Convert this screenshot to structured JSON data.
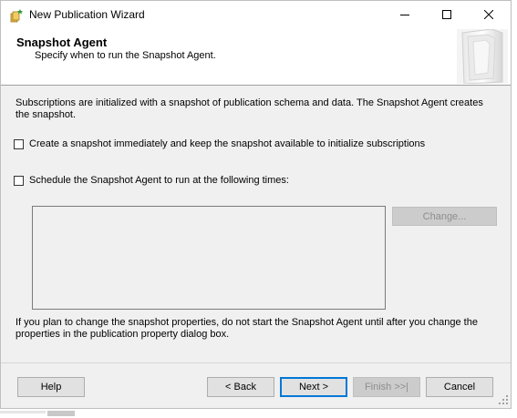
{
  "window": {
    "title": "New Publication Wizard",
    "controls": {
      "minimize": "minimize-icon",
      "maximize": "maximize-icon",
      "close": "close-icon"
    }
  },
  "header": {
    "title": "Snapshot Agent",
    "subtitle": "Specify when to run the Snapshot Agent."
  },
  "content": {
    "description": "Subscriptions are initialized with a snapshot of publication schema and data. The Snapshot Agent creates the snapshot.",
    "option_immediate": {
      "label": "Create a snapshot immediately and keep the snapshot available to initialize subscriptions",
      "checked": false
    },
    "option_schedule": {
      "label": "Schedule the Snapshot Agent to run at the following times:",
      "checked": false
    },
    "schedule_text": "",
    "change_button": "Change...",
    "note": "If you plan to change the snapshot properties, do not start the Snapshot Agent until after you change the properties in the publication property dialog box."
  },
  "footer": {
    "help": "Help",
    "back": "< Back",
    "next": "Next >",
    "finish": "Finish >>|",
    "cancel": "Cancel"
  },
  "colors": {
    "window_bg": "#f0f0f0",
    "accent_focus": "#0078d7",
    "disabled_text": "#8d8d8d"
  }
}
